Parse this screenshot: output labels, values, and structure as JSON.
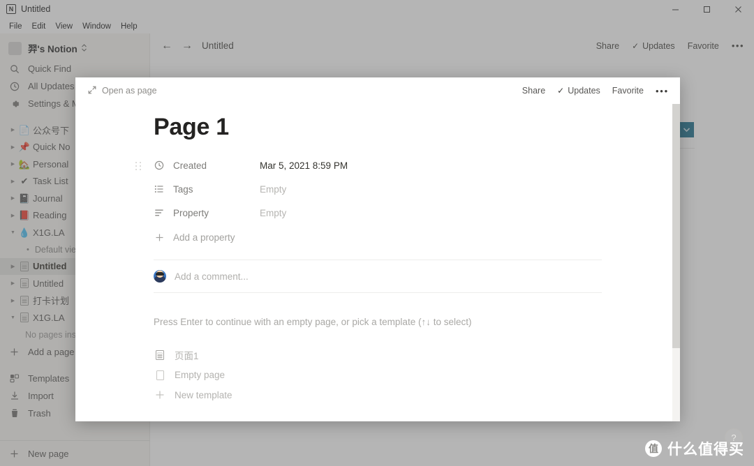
{
  "window": {
    "title": "Untitled",
    "logo_glyph": "N",
    "menus": [
      "File",
      "Edit",
      "View",
      "Window",
      "Help"
    ],
    "controls": {
      "minimize": "minimize-icon",
      "maximize": "maximize-icon",
      "close": "close-icon"
    }
  },
  "sidebar": {
    "workspace": {
      "name": "羿's Notion",
      "chevrons": "⌃⌄"
    },
    "quick_items": [
      {
        "label": "Quick Find",
        "icon": "search-icon"
      },
      {
        "label": "All Updates",
        "icon": "clock-icon"
      },
      {
        "label": "Settings & M",
        "icon": "gear-icon"
      }
    ],
    "tree": [
      {
        "label": "公众号下",
        "emoji": "📄",
        "arrow": "▶",
        "selected": false
      },
      {
        "label": "Quick No",
        "emoji": "📌",
        "arrow": "▶",
        "selected": false
      },
      {
        "label": "Personal",
        "emoji": "🏡",
        "arrow": "▶",
        "selected": false
      },
      {
        "label": "Task List",
        "emoji": "✔",
        "arrow": "▶",
        "selected": false
      },
      {
        "label": "Journal",
        "emoji": "📓",
        "arrow": "▶",
        "selected": false
      },
      {
        "label": "Reading",
        "emoji": "📕",
        "arrow": "▶",
        "selected": false
      },
      {
        "label": "X1G.LA",
        "emoji": "💧",
        "arrow": "▼",
        "selected": false
      }
    ],
    "default_view": "Default vie",
    "tree2": [
      {
        "label": "Untitled",
        "arrow": "▶",
        "selected": true
      },
      {
        "label": "Untitled",
        "arrow": "▶",
        "selected": false
      },
      {
        "label": "打卡计划",
        "arrow": "▶",
        "selected": false
      },
      {
        "label": "X1G.LA",
        "arrow": "▼",
        "selected": false
      }
    ],
    "no_pages": "No pages ins",
    "add_page": "Add a page",
    "tools": [
      {
        "label": "Templates",
        "icon": "templates-icon"
      },
      {
        "label": "Import",
        "icon": "import-icon"
      },
      {
        "label": "Trash",
        "icon": "trash-icon"
      }
    ],
    "new_page": "New page"
  },
  "content": {
    "back_arrow": "←",
    "forward_arrow": "→",
    "breadcrumb": "Untitled",
    "actions": {
      "share": "Share",
      "updates": "Updates",
      "favorite": "Favorite",
      "more": "•••",
      "check": "✓"
    },
    "teal_button_icon": "chevron-down-icon"
  },
  "modal": {
    "open_as_page": "Open as page",
    "expand_icon": "expand-icon",
    "actions": {
      "share": "Share",
      "updates": "Updates",
      "favorite": "Favorite",
      "more": "•••",
      "check": "✓"
    },
    "page_title": "Page 1",
    "properties": [
      {
        "label": "Created",
        "value": "Mar 5, 2021 8:59 PM",
        "icon": "clock-icon",
        "empty": false
      },
      {
        "label": "Tags",
        "value": "Empty",
        "icon": "list-icon",
        "empty": true
      },
      {
        "label": "Property",
        "value": "Empty",
        "icon": "text-lines-icon",
        "empty": true
      }
    ],
    "add_property": "Add a property",
    "comment_placeholder": "Add a comment...",
    "hint": "Press Enter to continue with an empty page, or pick a template (↑↓ to select)",
    "templates": [
      {
        "label": "页面1",
        "icon": "document-icon"
      },
      {
        "label": "Empty page",
        "icon": "blank-page-icon"
      },
      {
        "label": "New template",
        "icon": "plus-icon"
      }
    ]
  },
  "watermark": {
    "logo": "值",
    "text": "什么值得买",
    "help": "?"
  },
  "colors": {
    "teal_accent": "#1f7391",
    "sidebar_bg": "#f7f6f3",
    "overlay": "rgba(90,90,90,0.45)"
  }
}
